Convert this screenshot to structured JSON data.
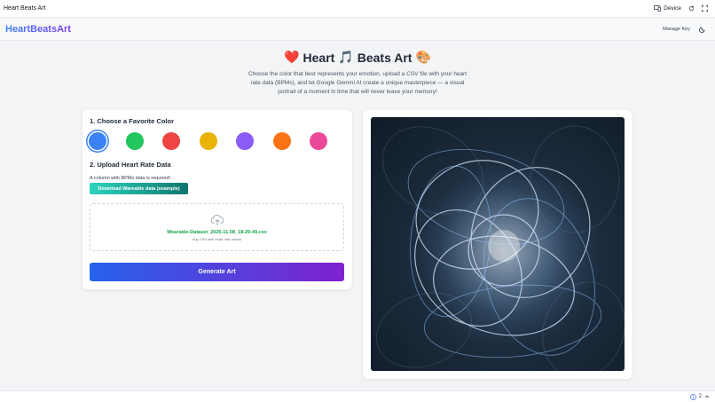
{
  "chrome": {
    "title": "Heart Beats Art",
    "device_label": "Device",
    "icons": [
      "device-icon",
      "refresh-icon",
      "fullscreen-icon"
    ]
  },
  "header": {
    "brand": "HeartBeatsArt",
    "manage_key": "Manage Key",
    "theme_icon": "moon-icon"
  },
  "hero": {
    "title": "Heart",
    "title_2": "Beats Art",
    "emoji_heart": "❤️",
    "emoji_music": "🎵",
    "emoji_palette": "🎨",
    "description": "Choose the color that best represents your emotion, upload a CSV file with your heart rate data (BPMs), and let Google Gemini AI create a unique masterpiece — a visual portrait of a moment in time that will never leave your memory!"
  },
  "form": {
    "section1_title": "1. Choose a Favorite Color",
    "colors": [
      {
        "name": "blue",
        "hex": "#3b82f6",
        "selected": true
      },
      {
        "name": "green",
        "hex": "#22c55e",
        "selected": false
      },
      {
        "name": "red",
        "hex": "#ef4444",
        "selected": false
      },
      {
        "name": "yellow",
        "hex": "#eab308",
        "selected": false
      },
      {
        "name": "purple",
        "hex": "#8b5cf6",
        "selected": false
      },
      {
        "name": "orange",
        "hex": "#f97316",
        "selected": false
      },
      {
        "name": "pink",
        "hex": "#ec4899",
        "selected": false
      }
    ],
    "section2_title": "2. Upload Heart Rate Data",
    "requirement": "A column with BPMs data is required!",
    "download_label": "Download Wareable data (example)",
    "file_name": "Wearable-Dataset_2025-11-08_18-29-40.csv",
    "file_hint": "Any CSV with heart rate values",
    "generate_label": "Generate Art"
  },
  "preview": {
    "description": "Generated abstract art image"
  },
  "footer": {
    "count": "2"
  }
}
